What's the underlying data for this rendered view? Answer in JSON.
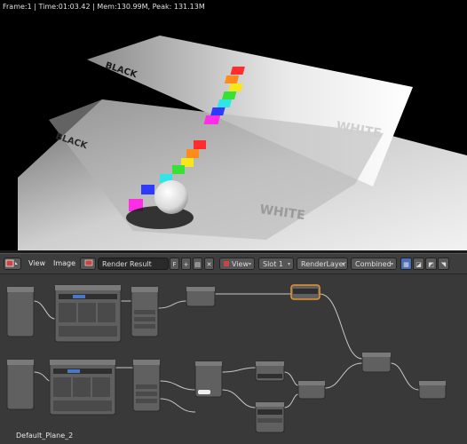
{
  "render_info": "Frame:1 | Time:01:03.42 | Mem:130.99M, Peak: 131.13M",
  "header": {
    "menu_view": "View",
    "menu_image": "Image",
    "image_name": "Render Result",
    "fake_user": "F",
    "view_dropdown": "View",
    "slot_dropdown": "Slot 1",
    "layer_dropdown": "RenderLayer",
    "pass_dropdown": "Combined"
  },
  "scene_text": {
    "black_far": "BLACK",
    "white_far": "WHITE",
    "black_near": "BLACK",
    "white_near": "WHITE"
  },
  "material_name": "Default_Plane_2",
  "colors": {
    "render_bg": "#000000",
    "header_bg": "#3d3d3d",
    "node_editor_bg": "#393939",
    "node_body": "#606060",
    "node_selected_outline": "#e8962a",
    "color_squares": [
      "#ff2d2d",
      "#ff8c1a",
      "#f5e61e",
      "#38e038",
      "#2ee6e6",
      "#2f3aff",
      "#ff2de6"
    ]
  },
  "icons": [
    "image-editor-type-icon",
    "plus-icon",
    "folder-icon",
    "close-icon",
    "checker-icon",
    "alpha-icon",
    "zbuffer-icon",
    "sample-icon"
  ]
}
